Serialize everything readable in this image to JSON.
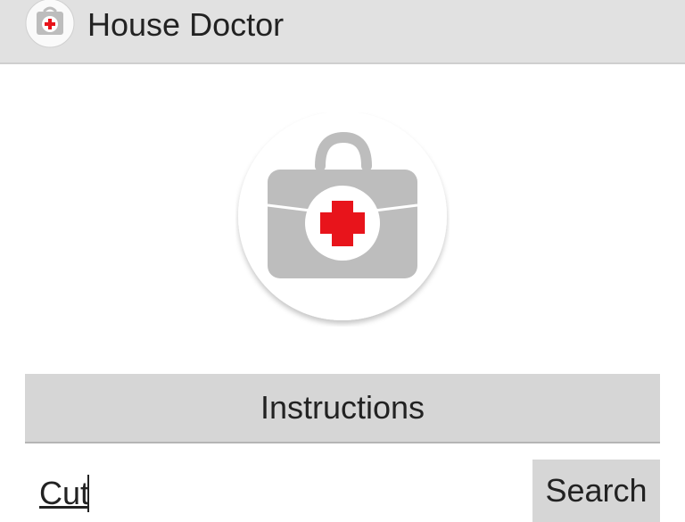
{
  "app": {
    "title": "House Doctor",
    "icon": "first-aid-kit-icon"
  },
  "main": {
    "logo_icon": "first-aid-kit-icon",
    "instructions_label": "Instructions"
  },
  "search": {
    "value": "Cut",
    "button_label": "Search"
  },
  "colors": {
    "action_bar": "#e1e1e1",
    "button": "#d6d6d6",
    "kit_gray": "#bdbdbd",
    "cross_red": "#e8141b"
  }
}
